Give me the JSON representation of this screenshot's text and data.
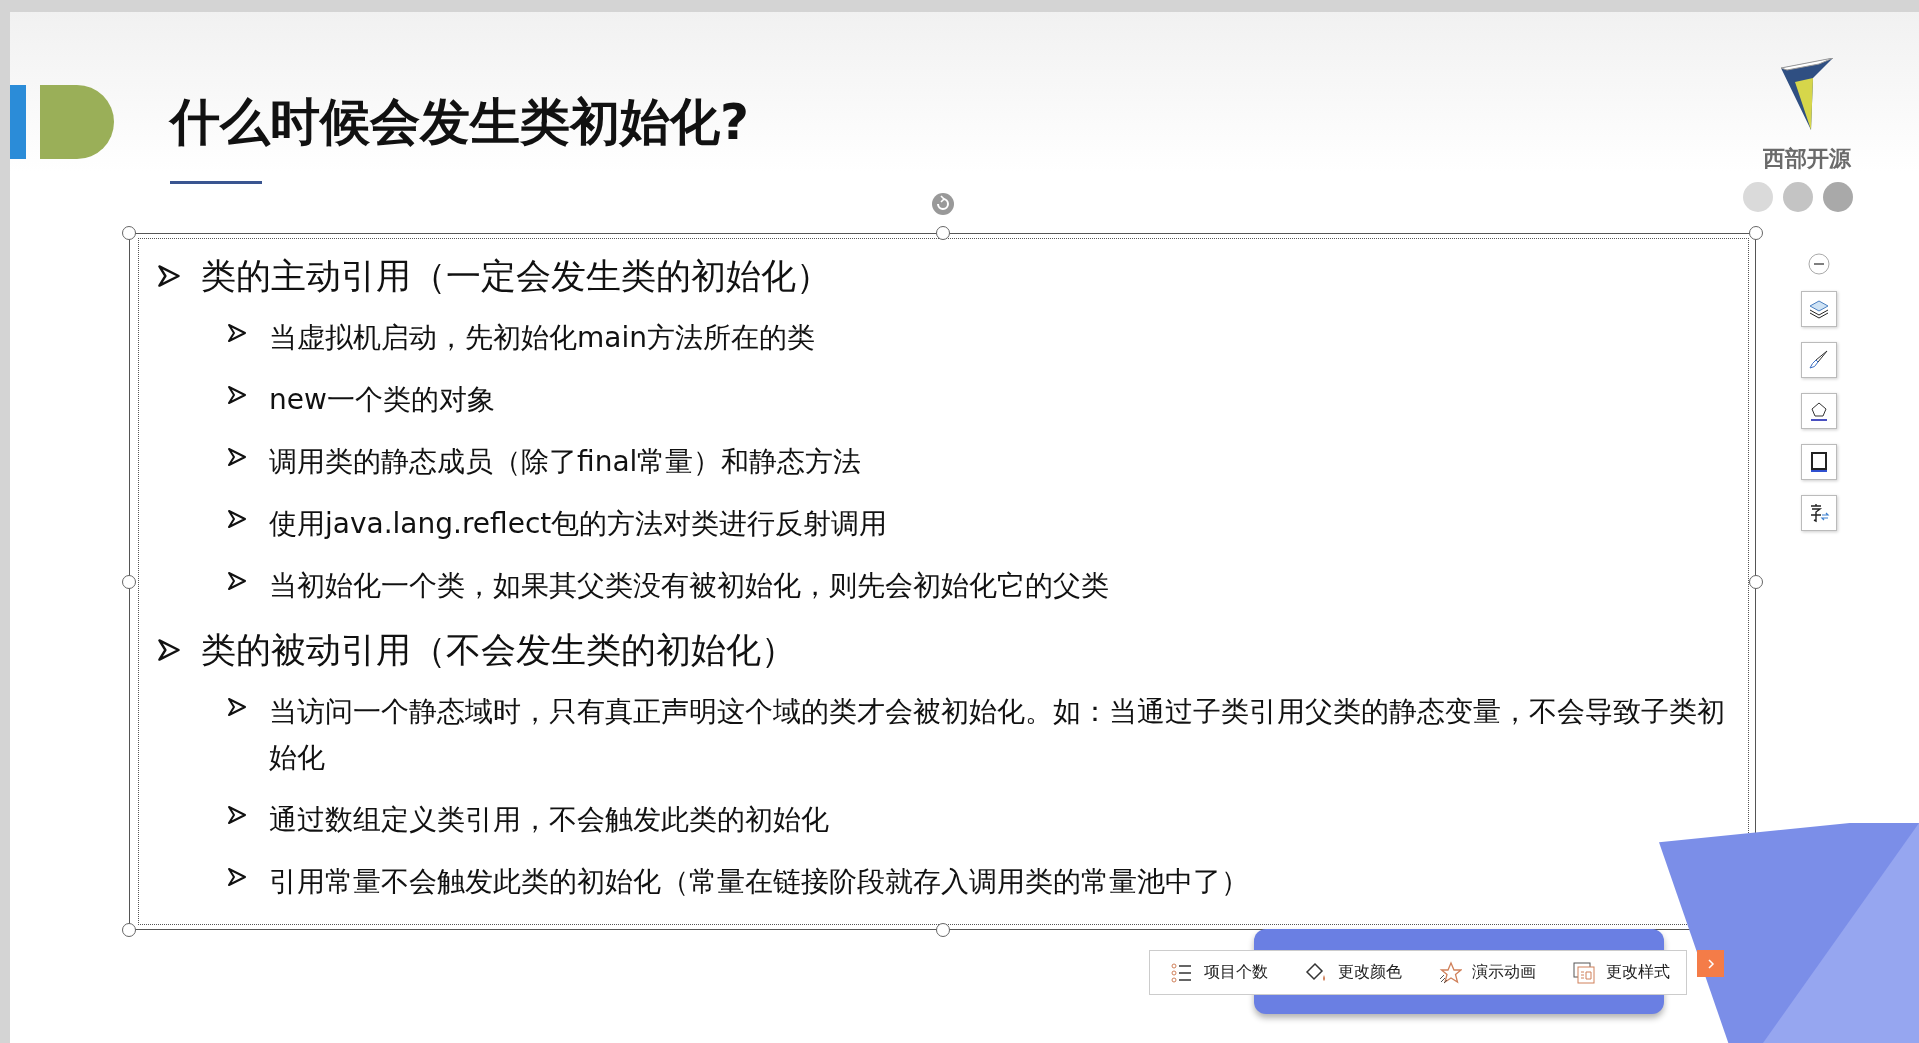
{
  "slide": {
    "title": "什么时候会发生类初始化?",
    "logo_text": "西部开源",
    "bullets": [
      {
        "text": "类的主动引用（一定会发生类的初始化）",
        "children": [
          {
            "text": "当虚拟机启动，先初始化main方法所在的类"
          },
          {
            "text": "new一个类的对象"
          },
          {
            "text": "调用类的静态成员（除了final常量）和静态方法"
          },
          {
            "text": "使用java.lang.reflect包的方法对类进行反射调用"
          },
          {
            "text": "当初始化一个类，如果其父类没有被初始化，则先会初始化它的父类"
          }
        ]
      },
      {
        "text": "类的被动引用（不会发生类的初始化）",
        "children": [
          {
            "text": "当访问一个静态域时，只有真正声明这个域的类才会被初始化。如：当通过子类引用父类的静态变量，不会导致子类初始化"
          },
          {
            "text": "通过数组定义类引用，不会触发此类的初始化"
          },
          {
            "text": "引用常量不会触发此类的初始化（常量在链接阶段就存入调用类的常量池中了）"
          }
        ]
      }
    ]
  },
  "bottom_toolbar": [
    {
      "label": "项目个数",
      "kind": "list"
    },
    {
      "label": "更改颜色",
      "kind": "fill"
    },
    {
      "label": "演示动画",
      "kind": "star"
    },
    {
      "label": "更改样式",
      "kind": "style"
    }
  ]
}
